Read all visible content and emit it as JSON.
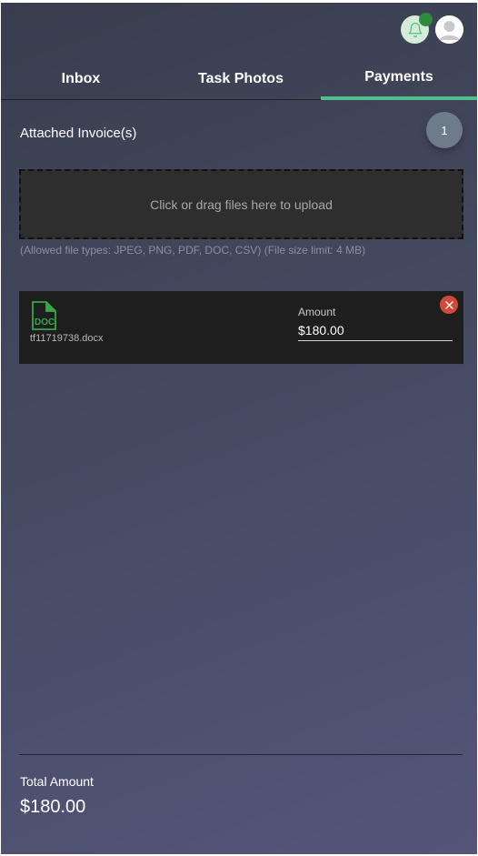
{
  "header": {
    "notification_icon": "bell-icon",
    "avatar_icon": "user-avatar-icon",
    "notification_dot_color": "#2e8b3e"
  },
  "tabs": [
    {
      "label": "Inbox",
      "active": false
    },
    {
      "label": "Task Photos",
      "active": false
    },
    {
      "label": "Payments",
      "active": true
    }
  ],
  "accent_color": "#4fc08d",
  "payments": {
    "attached_label": "Attached Invoice(s)",
    "attached_count": "1",
    "dropzone_text": "Click or drag files here to upload",
    "file_hint": "(Allowed file types: JPEG, PNG, PDF, DOC, CSV) (File size limit: 4 MB)",
    "invoices": [
      {
        "file_type_label": "DOC",
        "file_name": "tf11719738.docx",
        "amount_label": "Amount",
        "amount_value": "$180.00"
      }
    ],
    "total_label": "Total Amount",
    "total_value": "$180.00"
  }
}
